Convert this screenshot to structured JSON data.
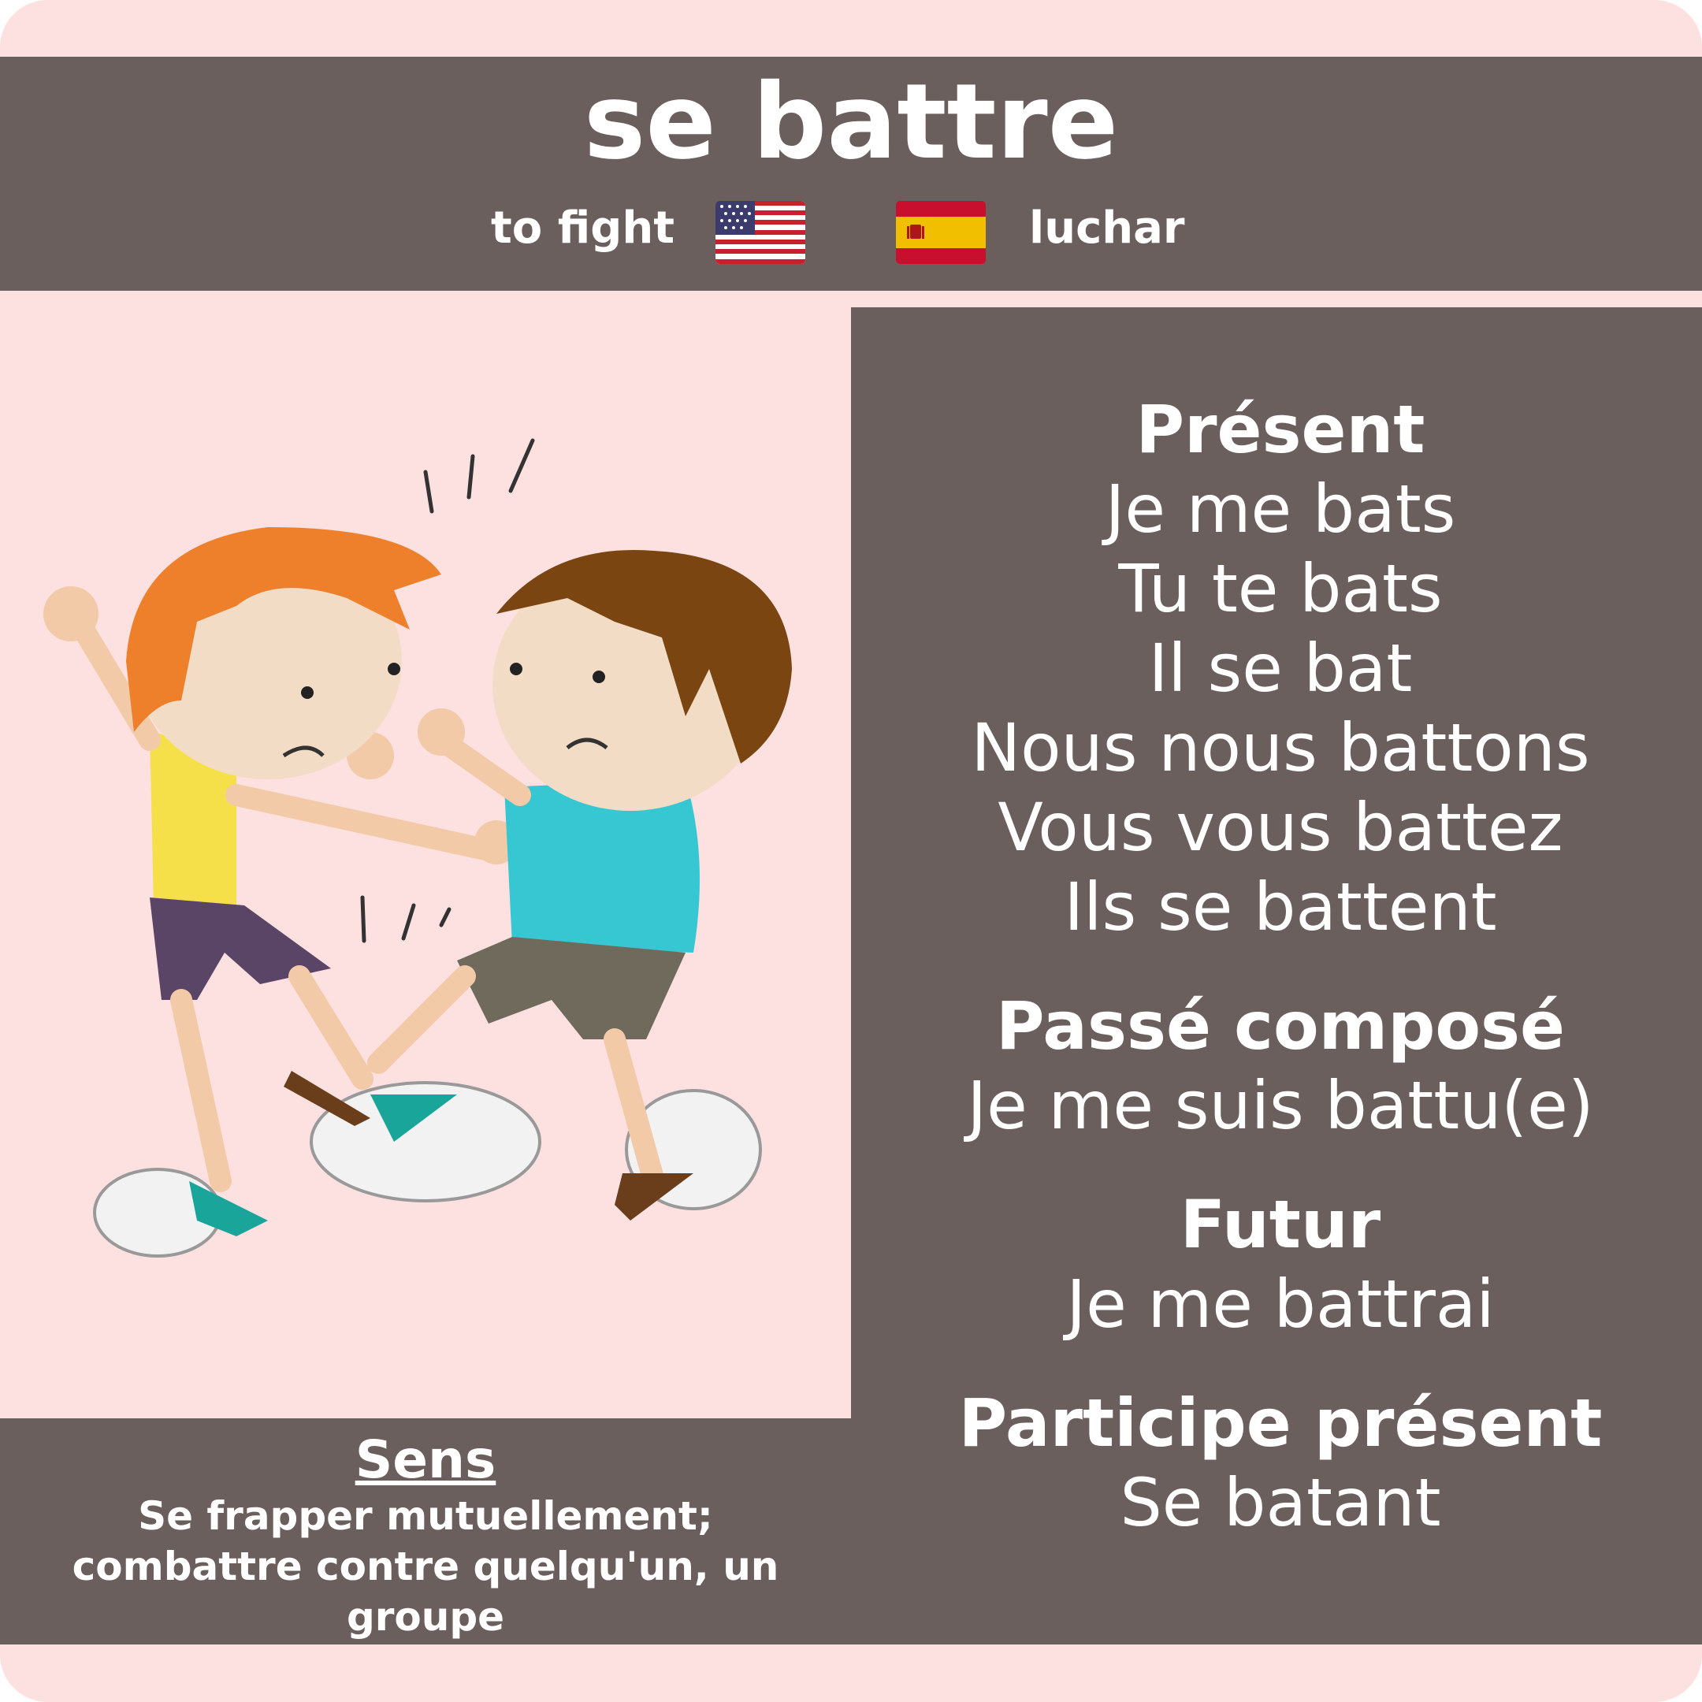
{
  "title": "se battre",
  "translations": {
    "english": "to fight",
    "spanish": "luchar",
    "english_flag": "us-flag-icon",
    "spanish_flag": "spain-flag-icon"
  },
  "sens": {
    "heading": "Sens",
    "definition": "Se frapper mutuellement; combattre contre quelqu'un, un groupe"
  },
  "conjugation": {
    "present": {
      "heading": "Présent",
      "lines": [
        "Je me bats",
        "Tu te bats",
        "Il se bat",
        "Nous nous battons",
        "Vous vous battez",
        "Ils se battent"
      ]
    },
    "passe_compose": {
      "heading": "Passé composé",
      "lines": [
        "Je me suis battu(e)"
      ]
    },
    "futur": {
      "heading": "Futur",
      "lines": [
        "Je me battrai"
      ]
    },
    "participe_present": {
      "heading": "Participe présent",
      "lines": [
        "Se batant"
      ]
    }
  },
  "colors": {
    "panel": "#6b5f5e",
    "background": "#fde0e0"
  }
}
